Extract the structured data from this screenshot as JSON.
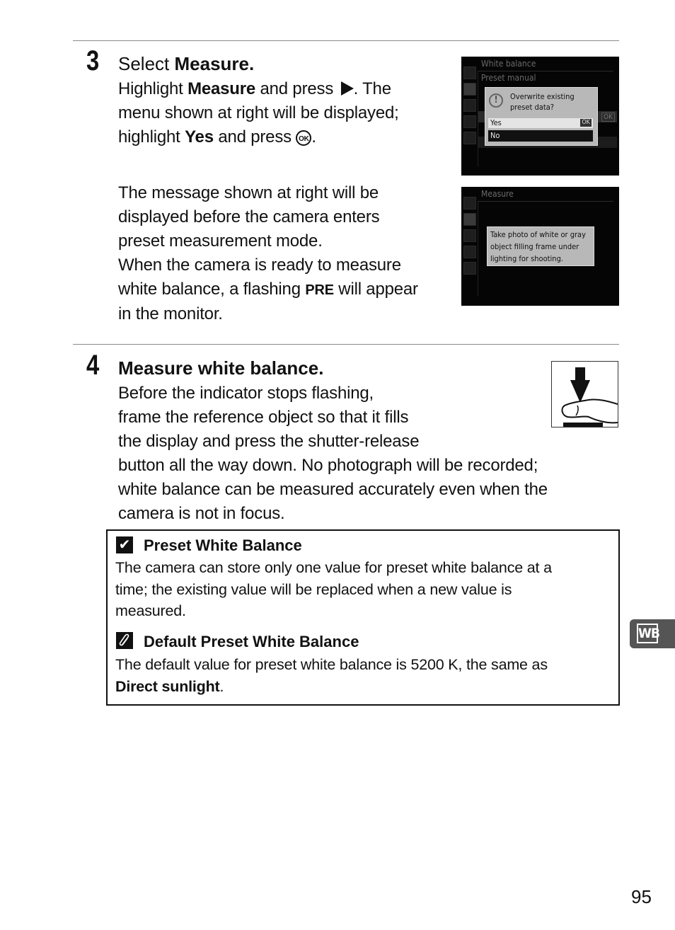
{
  "step3": {
    "number": "3",
    "title_prefix": "Select ",
    "title_bold": "Measure",
    "title_suffix": ".",
    "para1": {
      "t1": "Highlight ",
      "b1": "Measure",
      "t2": " and press ",
      "t3": ".  The",
      "line2": "menu shown at right will be displayed;",
      "t4": "highlight ",
      "b2": "Yes",
      "t5": " and press ",
      "ok_glyph": "OK",
      "t6": "."
    },
    "para2": {
      "line1": "The message shown at right will be",
      "line2": "displayed before the camera enters",
      "line3": "preset measurement mode.",
      "line4": "When the camera is ready to measure",
      "t1": "white balance, a flashing ",
      "pre": "PRE",
      "t2": " will appear",
      "line6": "in the monitor."
    },
    "screen1": {
      "menu_title": "White balance",
      "submenu_title": "Preset manual",
      "warning_icon": "!",
      "dialog_message_line1": "Overwrite existing",
      "dialog_message_line2": "preset data?",
      "option_yes": "Yes",
      "option_yes_badge": "OK",
      "option_no": "No",
      "background_ok_badge": "OK"
    },
    "screen2": {
      "menu_title": "Measure",
      "notice_line1": "Take photo of white or gray",
      "notice_line2": "object filling frame under",
      "notice_line3": "lighting for shooting."
    }
  },
  "step4": {
    "number": "4",
    "title": "Measure white balance.",
    "lines": [
      "Before the indicator stops flashing,",
      "frame the reference object so that it fills",
      "the display and press the shutter-release",
      "button all the way down.  No photograph will be recorded;",
      "white balance can be measured accurately even when the",
      "camera is not in focus."
    ]
  },
  "notes": {
    "note1": {
      "icon": "check-icon",
      "heading": "Preset White Balance",
      "lines": [
        "The camera can store only one value for preset white balance at a",
        "time; the existing value will be replaced when a new value is",
        "measured."
      ]
    },
    "note2": {
      "icon": "paperclip-icon",
      "heading": "Default Preset White Balance",
      "line1": "The default value for preset white balance is 5200 K, the same as",
      "bold": "Direct sunlight",
      "tail": "."
    }
  },
  "side_tab": {
    "label": "WB"
  },
  "page_number": "95"
}
